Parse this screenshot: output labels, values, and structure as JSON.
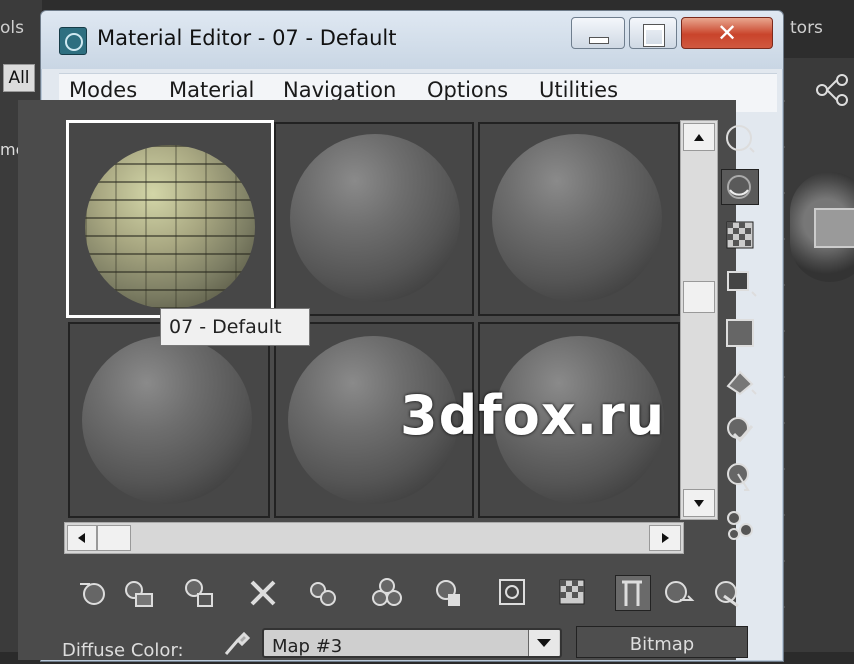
{
  "background": {
    "left_label": "ols",
    "all_button": "All",
    "name_field_label": "me",
    "right_label": "tors"
  },
  "window": {
    "title": "Material Editor - 07 - Default",
    "menu": [
      "Modes",
      "Material",
      "Navigation",
      "Options",
      "Utilities"
    ]
  },
  "slots": {
    "tooltip": "07 - Default",
    "count": 6
  },
  "watermark": "3dfox.ru",
  "param_row": {
    "label": "Diffuse Color:",
    "map_value": "Map #3",
    "type_button": "Bitmap"
  },
  "icons": {
    "sidebar": [
      "sample-type-icon",
      "backlight-icon",
      "background-icon",
      "uv-tiling-icon",
      "video-color-check-icon",
      "make-preview-icon",
      "options-icon",
      "select-by-material-icon",
      "material-map-navigator-icon"
    ],
    "toolbar": [
      "get-material-icon",
      "put-to-scene-icon",
      "assign-to-selection-icon",
      "reset-map-icon",
      "make-unique-icon",
      "put-to-library-icon",
      "material-id-channel-icon",
      "show-map-in-viewport-icon",
      "show-end-result-icon",
      "go-to-parent-icon",
      "go-forward-to-sibling-icon",
      "pick-material-icon"
    ]
  }
}
